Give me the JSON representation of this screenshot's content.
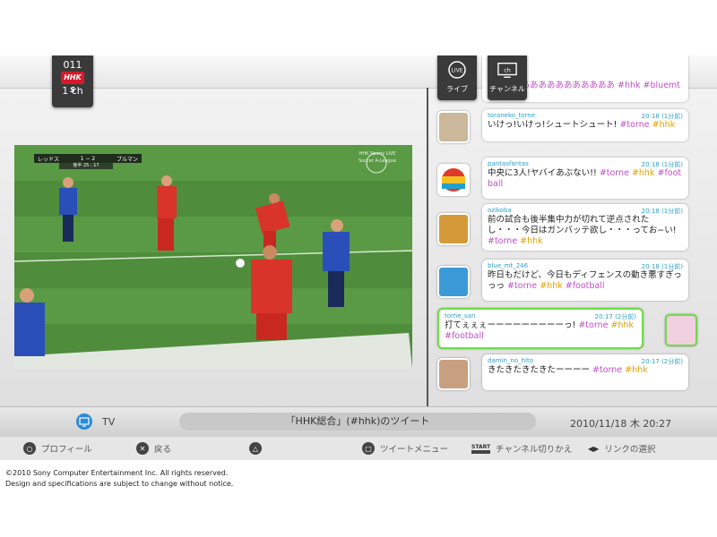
{
  "channel": {
    "number": "011",
    "logo": "HHK S",
    "ch": "1 ch"
  },
  "modes": [
    {
      "label": "ライブ",
      "icon": "live-icon",
      "badge": "LIVE"
    },
    {
      "label": "チャンネル",
      "icon": "channel-icon",
      "badge": "ch"
    }
  ],
  "score_overlay": {
    "team1": "レッドス",
    "score": "1 − 2",
    "team2": "ブルマン",
    "clock": "後半 25 : 17"
  },
  "broadcaster_overlay": "HHK Sports LIVE Soccer A-League",
  "tweets_top_partial": "ああああああああああああ #hhk #bluemt",
  "tweets": [
    {
      "user": "toraneko_torne",
      "time": "20:18 (1分前)",
      "text": "いけっ!いけっ!シュートシュート!",
      "tags": [
        "#torne",
        "#hhk"
      ],
      "avatar": "cat-avatar",
      "mine": false
    },
    {
      "user": "pantasfantas",
      "time": "20:18 (1分前)",
      "text": "中央に3人!ヤバイあぶない!!",
      "tags": [
        "#torne",
        "#hhk",
        "#football"
      ],
      "avatar": "ball-avatar",
      "mine": false
    },
    {
      "user": "ozikoba",
      "time": "20:18 (1分前)",
      "text": "前の試合も後半集中力が切れて逆点されたし・・・今日はガンバッテ欲し・・・ってお−い!",
      "tags": [
        "#torne",
        "#hhk"
      ],
      "avatar": "food-avatar",
      "mine": false
    },
    {
      "user": "blue_mt_246",
      "time": "20:18 (1分前)",
      "text": "昨日もだけど、今日もディフェンスの動き悪すぎっっっ",
      "tags": [
        "#torne",
        "#hhk",
        "#football"
      ],
      "avatar": "tree-avatar",
      "mine": false
    },
    {
      "user": "torne_san",
      "time": "20:17 (2分前)",
      "text": "打てぇぇぇーーーーーーーーーっ!",
      "tags": [
        "#torne",
        "#hhk",
        "#football"
      ],
      "avatar": "anime-avatar",
      "mine": true
    },
    {
      "user": "damin_no_hito",
      "time": "20:17 (2分前)",
      "text": "きたきたきたきたーーーー",
      "tags": [
        "#torne",
        "#hhk"
      ],
      "avatar": "person-avatar",
      "mine": false
    }
  ],
  "status": {
    "tv_label": "TV",
    "title": "「HHK総合」(#hhk)のツイート",
    "datetime": "2010/11/18 木 20:27"
  },
  "buttons": [
    {
      "symbol": "○",
      "label": "プロフィール"
    },
    {
      "symbol": "✕",
      "label": "戻る"
    },
    {
      "symbol": "△",
      "label": ""
    },
    {
      "symbol": "□",
      "label": "ツイートメニュー"
    },
    {
      "symbol": "START",
      "label": "チャンネル切りかえ"
    },
    {
      "symbol": "◀▶",
      "label": "リンクの選択"
    }
  ],
  "footer": {
    "copyright": "©2010 Sony Computer Entertainment Inc. All rights reserved.",
    "notice": "Design and specifications are subject to change without notice."
  },
  "colors": {
    "tag_hhk": "#e0a000",
    "tag_other": "#c04fc8",
    "user": "#2aa0c8",
    "mine_border": "#6edc4a"
  }
}
